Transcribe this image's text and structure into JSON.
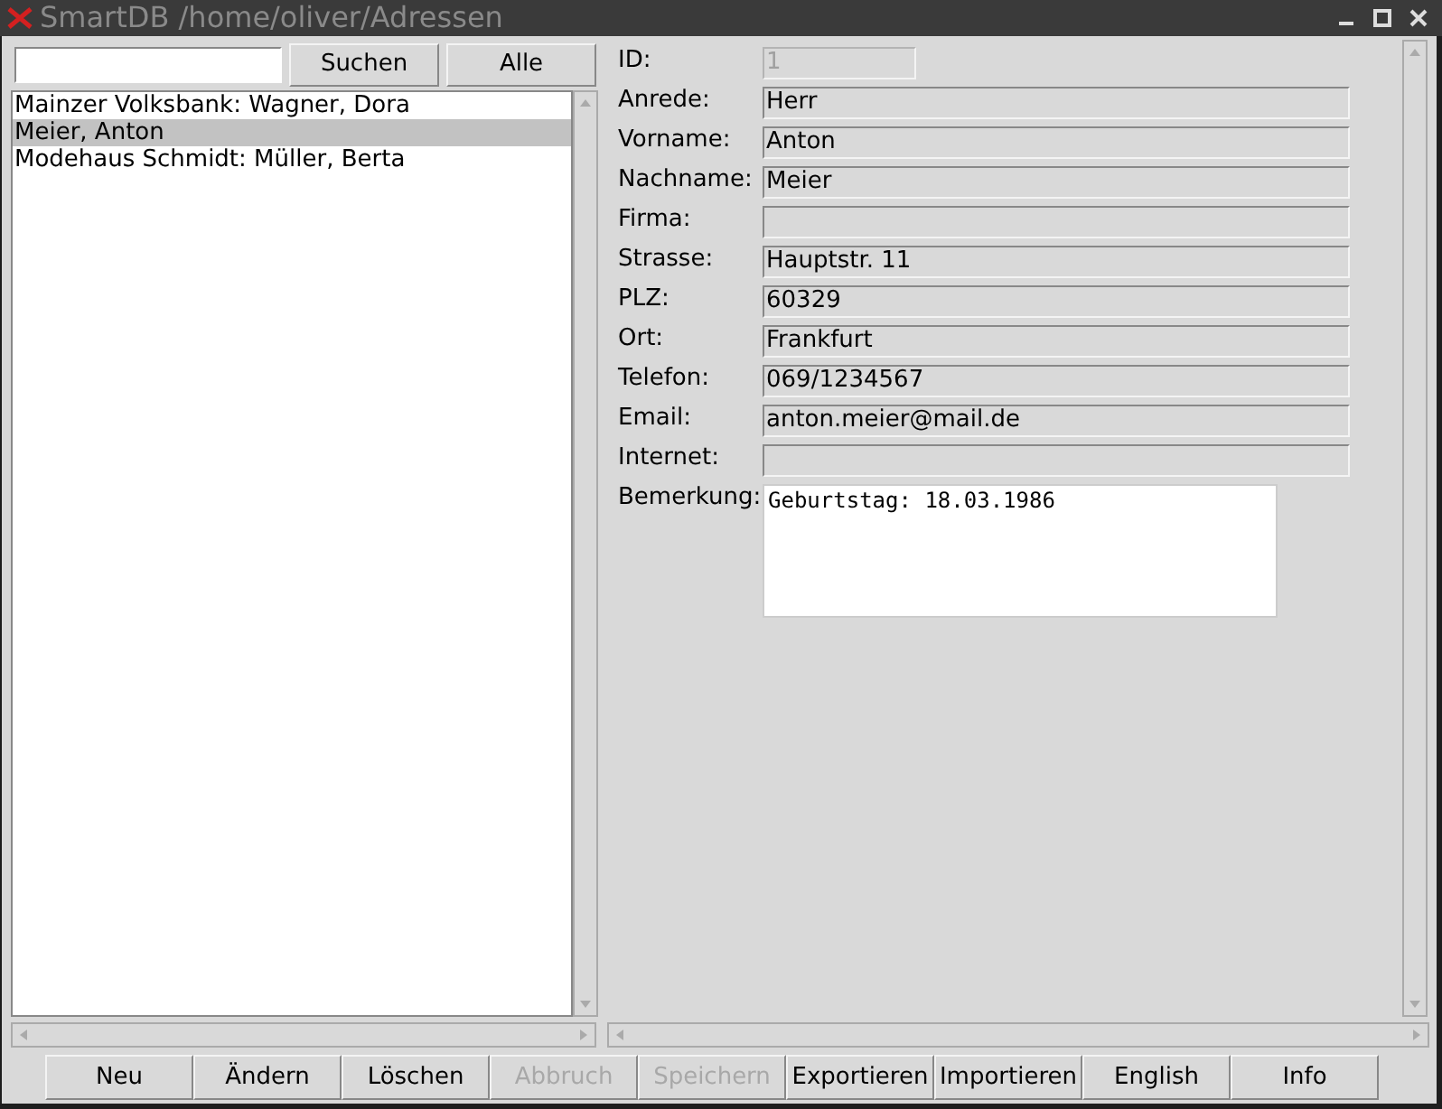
{
  "window": {
    "title": "SmartDB /home/oliver/Adressen"
  },
  "search_buttons": [
    {
      "label": "Suchen"
    },
    {
      "label": "Alle"
    }
  ],
  "list": [
    {
      "label": "Mainzer Volksbank: Wagner, Dora",
      "selected": false
    },
    {
      "label": "Meier, Anton",
      "selected": true
    },
    {
      "label": "Modehaus Schmidt: Müller, Berta",
      "selected": false
    }
  ],
  "fields": [
    {
      "label": "ID:",
      "value": "1",
      "kind": "short",
      "disabled": true
    },
    {
      "label": "Anrede:",
      "value": "Herr",
      "kind": "line",
      "disabled": false
    },
    {
      "label": "Vorname:",
      "value": "Anton",
      "kind": "line",
      "disabled": false
    },
    {
      "label": "Nachname:",
      "value": "Meier",
      "kind": "line",
      "disabled": false
    },
    {
      "label": "Firma:",
      "kind": "line",
      "disabled": false
    },
    {
      "label": "Strasse:",
      "value": "Hauptstr. 11",
      "kind": "line",
      "disabled": false
    },
    {
      "label": "PLZ:",
      "value": "60329",
      "kind": "line",
      "disabled": false
    },
    {
      "label": "Ort:",
      "value": "Frankfurt",
      "kind": "line",
      "disabled": false
    },
    {
      "label": "Telefon:",
      "value": "069/1234567",
      "kind": "line",
      "disabled": false
    },
    {
      "label": "Email:",
      "value": "anton.meier@mail.de",
      "kind": "line",
      "disabled": false
    },
    {
      "label": "Internet:",
      "kind": "line",
      "disabled": false
    },
    {
      "label": "Bemerkung:",
      "value": "Geburtstag: 18.03.1986",
      "kind": "textarea",
      "disabled": false
    }
  ],
  "buttons": [
    {
      "label": "Neu",
      "disabled": false
    },
    {
      "label": "Ändern",
      "disabled": false
    },
    {
      "label": "Löschen",
      "disabled": false
    },
    {
      "label": "Abbruch",
      "disabled": true
    },
    {
      "label": "Speichern",
      "disabled": true
    },
    {
      "label": "Exportieren",
      "disabled": false
    },
    {
      "label": "Importieren",
      "disabled": false
    },
    {
      "label": "English",
      "disabled": false
    },
    {
      "label": "Info",
      "disabled": false
    }
  ]
}
